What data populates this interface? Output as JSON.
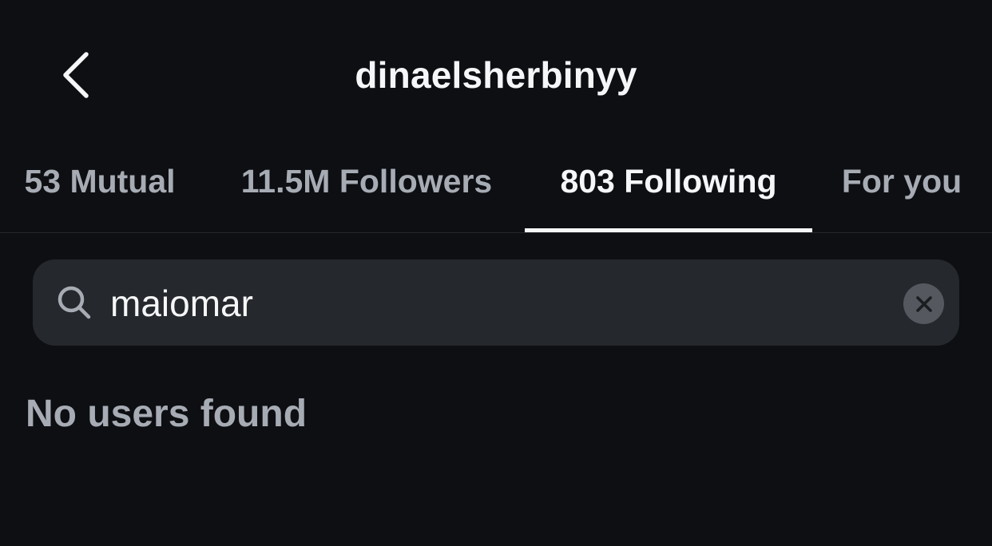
{
  "header": {
    "title": "dinaelsherbinyy",
    "back_icon": "chevron-left-icon"
  },
  "tabs": [
    {
      "label": "53 Mutual",
      "active": false
    },
    {
      "label": "11.5M Followers",
      "active": false
    },
    {
      "label": "803 Following",
      "active": true
    },
    {
      "label": "For you",
      "active": false
    }
  ],
  "search": {
    "value": "maiomar",
    "icon": "search-icon",
    "clear_icon": "close-icon"
  },
  "results": {
    "empty_message": "No users found"
  },
  "colors": {
    "background": "#0d0f13",
    "search_field": "#25282c",
    "primary_text": "#f5f6f7",
    "secondary_text": "#a7acb4",
    "clear_button": "#55585e"
  }
}
